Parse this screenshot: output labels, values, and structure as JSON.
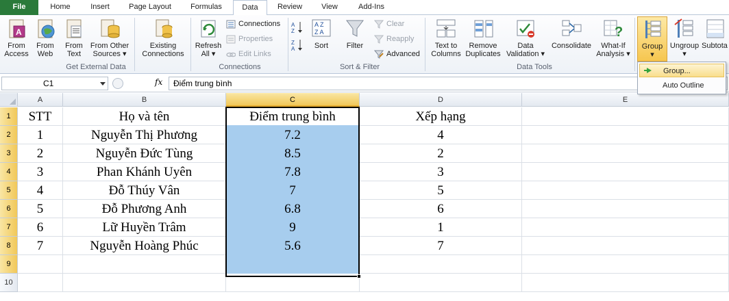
{
  "tabs": [
    "File",
    "Home",
    "Insert",
    "Page Layout",
    "Formulas",
    "Data",
    "Review",
    "View",
    "Add-Ins"
  ],
  "ribbon": {
    "get_external": {
      "label": "Get External Data",
      "buttons": [
        {
          "line1": "From",
          "line2": "Access"
        },
        {
          "line1": "From",
          "line2": "Web"
        },
        {
          "line1": "From",
          "line2": "Text"
        },
        {
          "line1": "From Other",
          "line2": "Sources ▾"
        },
        {
          "line1": "Existing",
          "line2": "Connections"
        }
      ]
    },
    "connections": {
      "label": "Connections",
      "refresh": {
        "line1": "Refresh",
        "line2": "All ▾"
      },
      "items": [
        "Connections",
        "Properties",
        "Edit Links"
      ]
    },
    "sort_filter": {
      "label": "Sort & Filter",
      "sort": "Sort",
      "filter": "Filter",
      "items": [
        "Clear",
        "Reapply",
        "Advanced"
      ]
    },
    "data_tools": {
      "label": "Data Tools",
      "buttons": [
        {
          "line1": "Text to",
          "line2": "Columns"
        },
        {
          "line1": "Remove",
          "line2": "Duplicates"
        },
        {
          "line1": "Data",
          "line2": "Validation ▾"
        },
        {
          "line1": "Consolidate",
          "line2": ""
        },
        {
          "line1": "What-If",
          "line2": "Analysis ▾"
        }
      ]
    },
    "outline": {
      "group": {
        "line1": "Group",
        "line2": "▾"
      },
      "ungroup": {
        "line1": "Ungroup",
        "line2": "▾"
      },
      "subtotal": {
        "line1": "Subtota",
        "line2": ""
      }
    }
  },
  "formula_bar": {
    "name_box": "C1",
    "fx": "fx",
    "content": "Điểm trung bình"
  },
  "columns": [
    "A",
    "B",
    "C",
    "D",
    "E"
  ],
  "rows": [
    "1",
    "2",
    "3",
    "4",
    "5",
    "6",
    "7",
    "8",
    "9",
    "10"
  ],
  "sheet": {
    "header": [
      "STT",
      "Họ và tên",
      "Điểm trung bình",
      "Xếp hạng"
    ],
    "records": [
      [
        "1",
        "Nguyễn Thị Phương",
        "7.2",
        "4"
      ],
      [
        "2",
        "Nguyễn Đức Tùng",
        "8.5",
        "2"
      ],
      [
        "3",
        "Phan Khánh Uyên",
        "7.8",
        "3"
      ],
      [
        "4",
        "Đỗ Thúy Vân",
        "7",
        "5"
      ],
      [
        "5",
        "Đỗ Phương Anh",
        "6.8",
        "6"
      ],
      [
        "6",
        "Lữ Huyền Trâm",
        "9",
        "1"
      ],
      [
        "7",
        "Nguyễn Hoàng Phúc",
        "5.6",
        "7"
      ]
    ]
  },
  "group_menu": {
    "items": [
      "Group...",
      "Auto Outline"
    ]
  }
}
